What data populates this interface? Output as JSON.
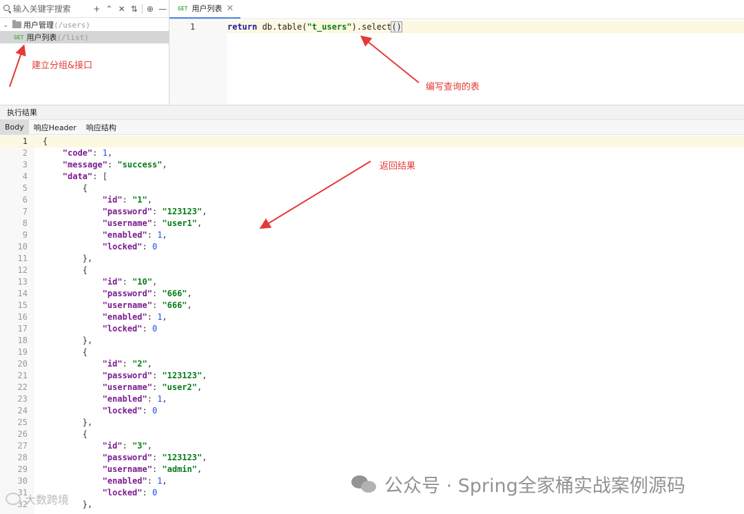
{
  "left_panel": {
    "search_placeholder": "输入关键字搜索",
    "toolbar_icons": [
      "add-icon",
      "expand-collapse-icon",
      "collapse-all-icon",
      "sort-icon",
      "locate-icon",
      "minimize-icon"
    ],
    "group": {
      "name": "用户管理",
      "path": "(/users)"
    },
    "item": {
      "method": "GET",
      "name": "用户列表",
      "path": "(/list)"
    }
  },
  "editor": {
    "tab": {
      "method": "GET",
      "label": "用户列表"
    },
    "line_number": "1",
    "code": {
      "keyword": "return",
      "before_string": " db.table(",
      "string": "\"t_users\"",
      "after_string": ").select",
      "parens": "()"
    }
  },
  "annotations": {
    "create_group": "建立分组&接口",
    "write_table": "编写查询的表",
    "return_result": "返回结果"
  },
  "results": {
    "header": "执行结果",
    "tabs": [
      "Body",
      "响应Header",
      "响应结构"
    ],
    "active_tab": "Body",
    "lines": [
      [
        [
          "p",
          "{"
        ]
      ],
      [
        [
          "p",
          "    "
        ],
        [
          "k",
          "\"code\""
        ],
        [
          "p",
          ": "
        ],
        [
          "num",
          "1"
        ],
        [
          "p",
          ","
        ]
      ],
      [
        [
          "p",
          "    "
        ],
        [
          "k",
          "\"message\""
        ],
        [
          "p",
          ": "
        ],
        [
          "s",
          "\"success\""
        ],
        [
          "p",
          ","
        ]
      ],
      [
        [
          "p",
          "    "
        ],
        [
          "k",
          "\"data\""
        ],
        [
          "p",
          ": ["
        ]
      ],
      [
        [
          "p",
          "        {"
        ]
      ],
      [
        [
          "p",
          "            "
        ],
        [
          "k",
          "\"id\""
        ],
        [
          "p",
          ": "
        ],
        [
          "s",
          "\"1\""
        ],
        [
          "p",
          ","
        ]
      ],
      [
        [
          "p",
          "            "
        ],
        [
          "k",
          "\"password\""
        ],
        [
          "p",
          ": "
        ],
        [
          "s",
          "\"123123\""
        ],
        [
          "p",
          ","
        ]
      ],
      [
        [
          "p",
          "            "
        ],
        [
          "k",
          "\"username\""
        ],
        [
          "p",
          ": "
        ],
        [
          "s",
          "\"user1\""
        ],
        [
          "p",
          ","
        ]
      ],
      [
        [
          "p",
          "            "
        ],
        [
          "k",
          "\"enabled\""
        ],
        [
          "p",
          ": "
        ],
        [
          "num",
          "1"
        ],
        [
          "p",
          ","
        ]
      ],
      [
        [
          "p",
          "            "
        ],
        [
          "k",
          "\"locked\""
        ],
        [
          "p",
          ": "
        ],
        [
          "num",
          "0"
        ]
      ],
      [
        [
          "p",
          "        },"
        ]
      ],
      [
        [
          "p",
          "        {"
        ]
      ],
      [
        [
          "p",
          "            "
        ],
        [
          "k",
          "\"id\""
        ],
        [
          "p",
          ": "
        ],
        [
          "s",
          "\"10\""
        ],
        [
          "p",
          ","
        ]
      ],
      [
        [
          "p",
          "            "
        ],
        [
          "k",
          "\"password\""
        ],
        [
          "p",
          ": "
        ],
        [
          "s",
          "\"666\""
        ],
        [
          "p",
          ","
        ]
      ],
      [
        [
          "p",
          "            "
        ],
        [
          "k",
          "\"username\""
        ],
        [
          "p",
          ": "
        ],
        [
          "s",
          "\"666\""
        ],
        [
          "p",
          ","
        ]
      ],
      [
        [
          "p",
          "            "
        ],
        [
          "k",
          "\"enabled\""
        ],
        [
          "p",
          ": "
        ],
        [
          "num",
          "1"
        ],
        [
          "p",
          ","
        ]
      ],
      [
        [
          "p",
          "            "
        ],
        [
          "k",
          "\"locked\""
        ],
        [
          "p",
          ": "
        ],
        [
          "num",
          "0"
        ]
      ],
      [
        [
          "p",
          "        },"
        ]
      ],
      [
        [
          "p",
          "        {"
        ]
      ],
      [
        [
          "p",
          "            "
        ],
        [
          "k",
          "\"id\""
        ],
        [
          "p",
          ": "
        ],
        [
          "s",
          "\"2\""
        ],
        [
          "p",
          ","
        ]
      ],
      [
        [
          "p",
          "            "
        ],
        [
          "k",
          "\"password\""
        ],
        [
          "p",
          ": "
        ],
        [
          "s",
          "\"123123\""
        ],
        [
          "p",
          ","
        ]
      ],
      [
        [
          "p",
          "            "
        ],
        [
          "k",
          "\"username\""
        ],
        [
          "p",
          ": "
        ],
        [
          "s",
          "\"user2\""
        ],
        [
          "p",
          ","
        ]
      ],
      [
        [
          "p",
          "            "
        ],
        [
          "k",
          "\"enabled\""
        ],
        [
          "p",
          ": "
        ],
        [
          "num",
          "1"
        ],
        [
          "p",
          ","
        ]
      ],
      [
        [
          "p",
          "            "
        ],
        [
          "k",
          "\"locked\""
        ],
        [
          "p",
          ": "
        ],
        [
          "num",
          "0"
        ]
      ],
      [
        [
          "p",
          "        },"
        ]
      ],
      [
        [
          "p",
          "        {"
        ]
      ],
      [
        [
          "p",
          "            "
        ],
        [
          "k",
          "\"id\""
        ],
        [
          "p",
          ": "
        ],
        [
          "s",
          "\"3\""
        ],
        [
          "p",
          ","
        ]
      ],
      [
        [
          "p",
          "            "
        ],
        [
          "k",
          "\"password\""
        ],
        [
          "p",
          ": "
        ],
        [
          "s",
          "\"123123\""
        ],
        [
          "p",
          ","
        ]
      ],
      [
        [
          "p",
          "            "
        ],
        [
          "k",
          "\"username\""
        ],
        [
          "p",
          ": "
        ],
        [
          "s",
          "\"admin\""
        ],
        [
          "p",
          ","
        ]
      ],
      [
        [
          "p",
          "            "
        ],
        [
          "k",
          "\"enabled\""
        ],
        [
          "p",
          ": "
        ],
        [
          "num",
          "1"
        ],
        [
          "p",
          ","
        ]
      ],
      [
        [
          "p",
          "            "
        ],
        [
          "k",
          "\"locked\""
        ],
        [
          "p",
          ": "
        ],
        [
          "num",
          "0"
        ]
      ],
      [
        [
          "p",
          "        },"
        ]
      ]
    ]
  },
  "watermarks": {
    "wechat": "公众号 · Spring全家桶实战案例源码",
    "weibo": "大数跨境"
  }
}
